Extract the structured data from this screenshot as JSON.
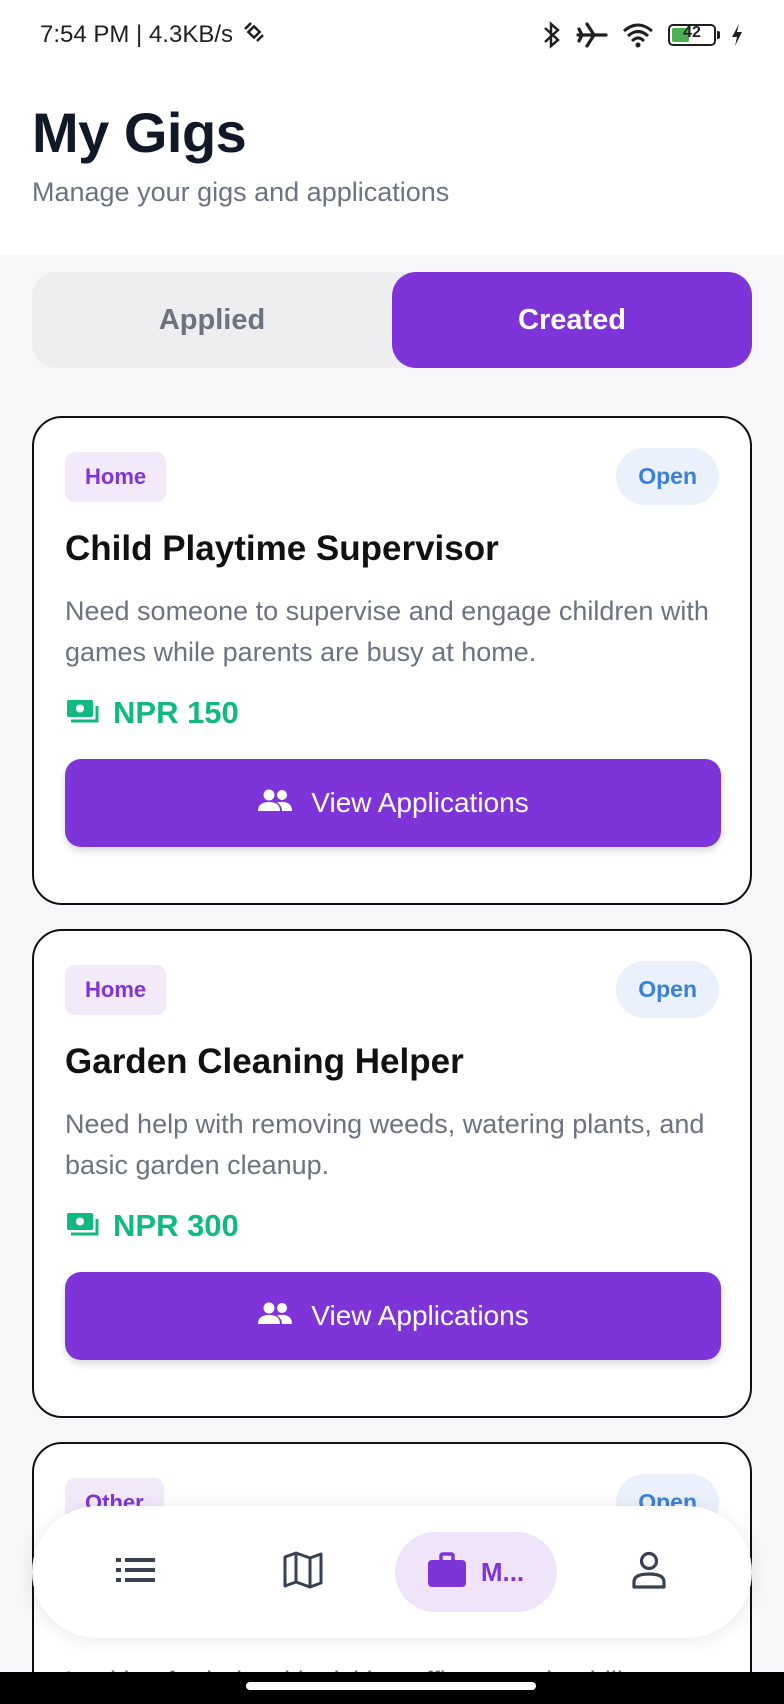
{
  "status_bar": {
    "time": "7:54 PM | 4.3KB/s",
    "battery": "42"
  },
  "header": {
    "title": "My Gigs",
    "subtitle": "Manage your gigs and applications"
  },
  "tabs": [
    {
      "label": "Applied",
      "active": false
    },
    {
      "label": "Created",
      "active": true
    }
  ],
  "gigs": [
    {
      "category": "Home",
      "status": "Open",
      "title": "Child Playtime Supervisor",
      "description": "Need someone to supervise and engage children with games while parents are busy at home.",
      "price": "NPR 150",
      "button_label": "View Applications"
    },
    {
      "category": "Home",
      "status": "Open",
      "title": "Garden Cleaning Helper",
      "description": "Need help with removing weeds, watering plants, and basic garden cleanup.",
      "price": "NPR 300",
      "button_label": "View Applications"
    },
    {
      "category": "Other",
      "status": "Open",
      "title": "",
      "description": "Looking for help with visiting offices, paying bills,",
      "price": "",
      "button_label": ""
    }
  ],
  "bottom_nav": {
    "items": [
      {
        "icon": "list-icon"
      },
      {
        "icon": "map-icon"
      },
      {
        "icon": "briefcase-icon",
        "label": "M..."
      },
      {
        "icon": "person-icon"
      }
    ]
  },
  "colors": {
    "accent": "#7e34d8",
    "price": "#10b981",
    "status": "#3b7fde"
  }
}
